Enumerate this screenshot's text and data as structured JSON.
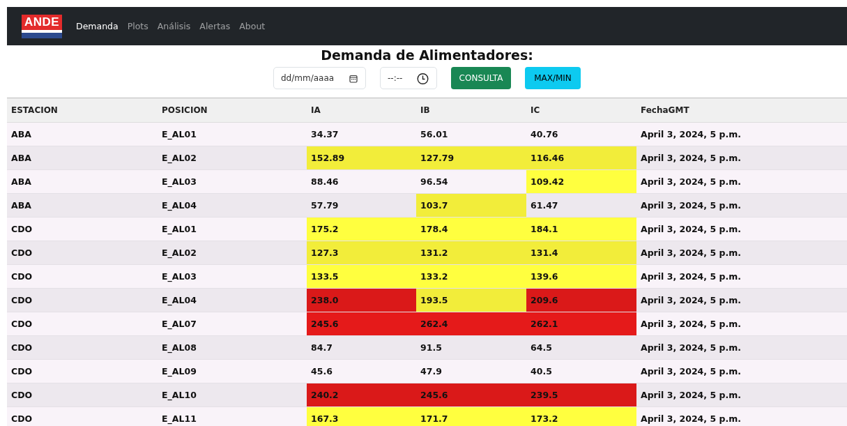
{
  "navbar": {
    "logo": "ANDE",
    "links": [
      {
        "label": "Demanda",
        "selected": true
      },
      {
        "label": "Plots",
        "selected": false
      },
      {
        "label": "Análisis",
        "selected": false
      },
      {
        "label": "Alertas",
        "selected": false
      },
      {
        "label": "About",
        "selected": false
      }
    ]
  },
  "heading": "Demanda de Alimentadores:",
  "controls": {
    "date": {
      "placeholder": "dd/mm/aaaa"
    },
    "time": {
      "placeholder": "--:--"
    },
    "buttons": [
      {
        "label": "CONSULTA",
        "kind": "success"
      },
      {
        "label": "MAX/MIN",
        "kind": "info"
      }
    ]
  },
  "table": {
    "columns": [
      "ESTACION",
      "POSICION",
      "IA",
      "IB",
      "IC",
      "FechaGMT"
    ],
    "rows": [
      {
        "estacion": "ABA",
        "posicion": "E_AL01",
        "currents": [
          {
            "value": "34.37"
          },
          {
            "value": "56.01"
          },
          {
            "value": "40.76"
          }
        ],
        "fecha": "April 3, 2024, 5 p.m."
      },
      {
        "estacion": "ABA",
        "posicion": "E_AL02",
        "currents": [
          {
            "value": "152.89",
            "color": "#f2ed3a"
          },
          {
            "value": "127.79",
            "color": "#f2ed3a"
          },
          {
            "value": "116.46",
            "color": "#f2ed3a"
          }
        ],
        "fecha": "April 3, 2024, 5 p.m."
      },
      {
        "estacion": "ABA",
        "posicion": "E_AL03",
        "currents": [
          {
            "value": "88.46"
          },
          {
            "value": "96.54"
          },
          {
            "value": "109.42",
            "color": "#ffff3f"
          }
        ],
        "fecha": "April 3, 2024, 5 p.m."
      },
      {
        "estacion": "ABA",
        "posicion": "E_AL04",
        "currents": [
          {
            "value": "57.79"
          },
          {
            "value": "103.7",
            "color": "#f2ed3a"
          },
          {
            "value": "61.47"
          }
        ],
        "fecha": "April 3, 2024, 5 p.m."
      },
      {
        "estacion": "CDO",
        "posicion": "E_AL01",
        "currents": [
          {
            "value": "175.2",
            "color": "#ffff3f"
          },
          {
            "value": "178.4",
            "color": "#ffff3f"
          },
          {
            "value": "184.1",
            "color": "#ffff3f"
          }
        ],
        "fecha": "April 3, 2024, 5 p.m."
      },
      {
        "estacion": "CDO",
        "posicion": "E_AL02",
        "currents": [
          {
            "value": "127.3",
            "color": "#f2ed3a"
          },
          {
            "value": "131.2",
            "color": "#f2ed3a"
          },
          {
            "value": "131.4",
            "color": "#f2ed3a"
          }
        ],
        "fecha": "April 3, 2024, 5 p.m."
      },
      {
        "estacion": "CDO",
        "posicion": "E_AL03",
        "currents": [
          {
            "value": "133.5",
            "color": "#ffff3f"
          },
          {
            "value": "133.2",
            "color": "#ffff3f"
          },
          {
            "value": "139.6",
            "color": "#ffff3f"
          }
        ],
        "fecha": "April 3, 2024, 5 p.m."
      },
      {
        "estacion": "CDO",
        "posicion": "E_AL04",
        "currents": [
          {
            "value": "238.0",
            "color": "#da1919"
          },
          {
            "value": "193.5",
            "color": "#f2ed3a"
          },
          {
            "value": "209.6",
            "color": "#da1919"
          }
        ],
        "fecha": "April 3, 2024, 5 p.m."
      },
      {
        "estacion": "CDO",
        "posicion": "E_AL07",
        "currents": [
          {
            "value": "245.6",
            "color": "#e51a1a"
          },
          {
            "value": "262.4",
            "color": "#e51a1a"
          },
          {
            "value": "262.1",
            "color": "#e51a1a"
          }
        ],
        "fecha": "April 3, 2024, 5 p.m."
      },
      {
        "estacion": "CDO",
        "posicion": "E_AL08",
        "currents": [
          {
            "value": "84.7"
          },
          {
            "value": "91.5"
          },
          {
            "value": "64.5"
          }
        ],
        "fecha": "April 3, 2024, 5 p.m."
      },
      {
        "estacion": "CDO",
        "posicion": "E_AL09",
        "currents": [
          {
            "value": "45.6"
          },
          {
            "value": "47.9"
          },
          {
            "value": "40.5"
          }
        ],
        "fecha": "April 3, 2024, 5 p.m."
      },
      {
        "estacion": "CDO",
        "posicion": "E_AL10",
        "currents": [
          {
            "value": "240.2",
            "color": "#da1919"
          },
          {
            "value": "245.6",
            "color": "#da1919"
          },
          {
            "value": "239.5",
            "color": "#da1919"
          }
        ],
        "fecha": "April 3, 2024, 5 p.m."
      },
      {
        "estacion": "CDO",
        "posicion": "E_AL11",
        "currents": [
          {
            "value": "167.3",
            "color": "#ffff3f"
          },
          {
            "value": "171.7",
            "color": "#ffff3f"
          },
          {
            "value": "173.2",
            "color": "#ffff3f"
          }
        ],
        "fecha": "April 3, 2024, 5 p.m."
      }
    ]
  }
}
